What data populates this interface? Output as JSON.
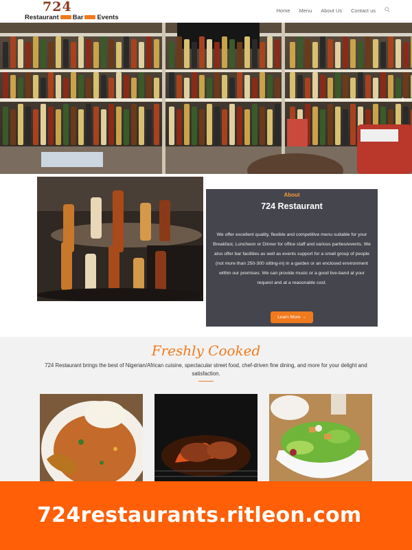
{
  "brand": {
    "logo_number": "724",
    "logo_word_1": "Restaurant",
    "logo_word_2": "Bar",
    "logo_word_3": "Events"
  },
  "nav": {
    "items": [
      {
        "label": "Home"
      },
      {
        "label": "Menu"
      },
      {
        "label": "About Us"
      },
      {
        "label": "Contact us"
      }
    ],
    "search_icon": "search-icon"
  },
  "hero": {
    "next_icon": "chevron-right-icon"
  },
  "about": {
    "eyebrow": "About",
    "title": "724 Restaurant",
    "body": "We offer excellent quality, flexible and competitive menu suitable for your Breakfast, Luncheon or Dinner for office staff and various parties/events. We also offer bar facilities as well as events support for a small group of people (not more than 250-300 sitting-in) in a garden or an enclosed environment within our premises. We can provide music or a good live-band at your request and at a reasonable cost.",
    "button_label": "Learn More →"
  },
  "fresh": {
    "title": "Freshly Cooked",
    "text": "724 Restaurant brings the best of Nigerian/African cuisine, spectacular street food, chef-driven fine dining, and more for your delight and satisfaction."
  },
  "banner": {
    "text": "724restaurants.ritleon.com"
  },
  "colors": {
    "accent": "#f07a1e",
    "banner": "#ff5f06",
    "card": "#45454d"
  }
}
